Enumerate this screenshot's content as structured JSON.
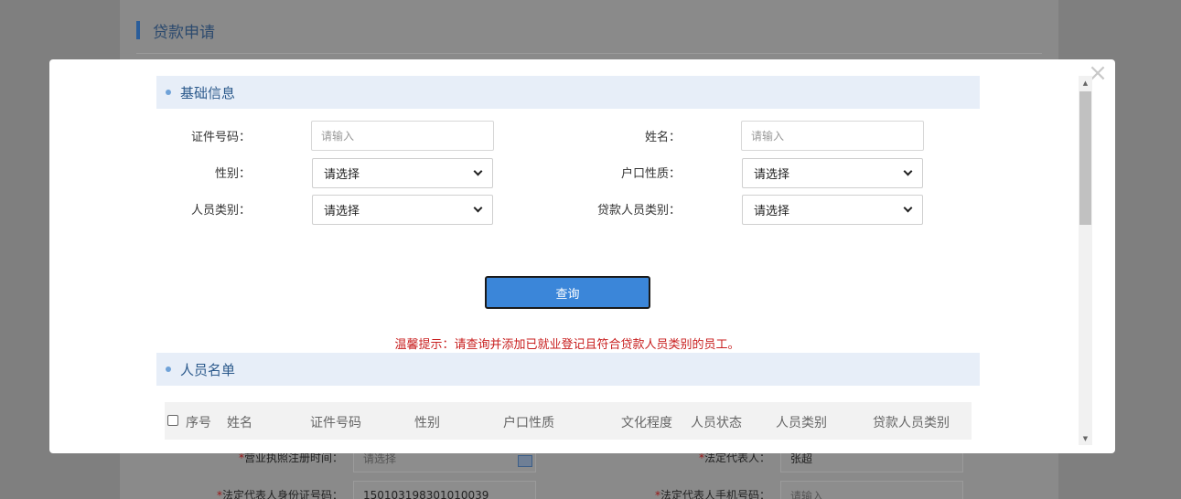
{
  "background": {
    "page_title": "贷款申请",
    "rows": [
      {
        "label": "营业执照注册时间：",
        "value": "请选择"
      },
      {
        "label": "法定代表人：",
        "value": "张超"
      },
      {
        "label": "法定代表人身份证号码：",
        "value": "150103198301010039"
      },
      {
        "label": "法定代表人手机号码：",
        "value": "请输入"
      }
    ],
    "required_mark": "*"
  },
  "modal": {
    "close_glyph": "×",
    "basic_info": {
      "title": "基础信息",
      "fields": {
        "id_number": {
          "label": "证件号码：",
          "placeholder": "请输入"
        },
        "name": {
          "label": "姓名：",
          "placeholder": "请输入"
        },
        "gender": {
          "label": "性别：",
          "selected": "请选择"
        },
        "household": {
          "label": "户口性质：",
          "selected": "请选择"
        },
        "person_category": {
          "label": "人员类别：",
          "selected": "请选择"
        },
        "loan_category": {
          "label": "贷款人员类别：",
          "selected": "请选择"
        }
      }
    },
    "query_button": "查询",
    "tip": "温馨提示：请查询并添加已就业登记且符合贷款人员类别的员工。",
    "person_list": {
      "title": "人员名单",
      "columns": [
        "序号",
        "姓名",
        "证件号码",
        "性别",
        "户口性质",
        "文化程度",
        "人员状态",
        "人员类别",
        "贷款人员类别"
      ]
    }
  },
  "colors": {
    "accent": "#3b86d9",
    "section_bg": "#e7eef8",
    "tip": "#c81e1e"
  }
}
